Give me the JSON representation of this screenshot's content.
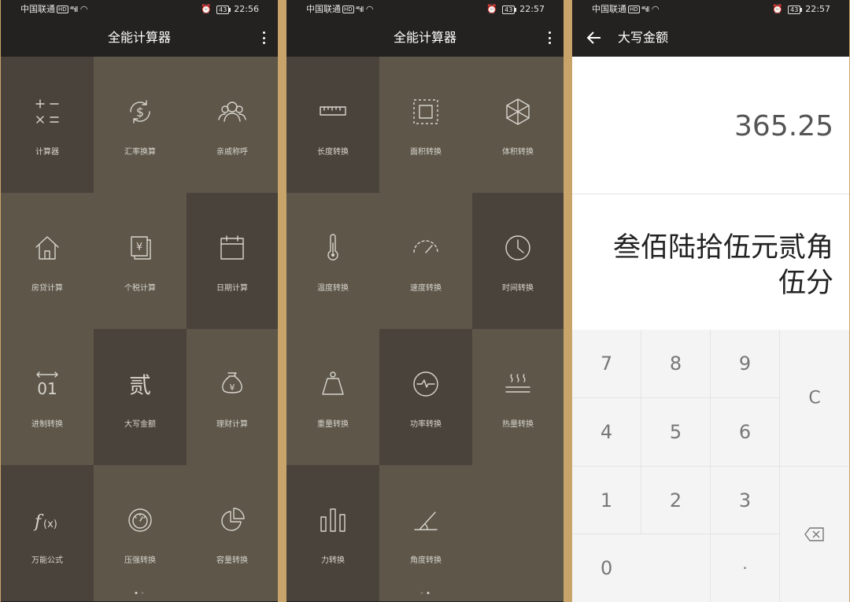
{
  "status": {
    "carrier": "中国联通",
    "hd": "HD",
    "signal": "⁴⁶ıll",
    "battery": "43",
    "time1": "22:56",
    "time2": "22:57",
    "time3": "22:57"
  },
  "app_title": "全能计算器",
  "page1_tiles": [
    {
      "label": "计算器",
      "icon": "plus-minus-times-equals-icon"
    },
    {
      "label": "汇率换算",
      "icon": "currency-exchange-icon"
    },
    {
      "label": "亲戚称呼",
      "icon": "people-group-icon"
    },
    {
      "label": "房贷计算",
      "icon": "house-icon"
    },
    {
      "label": "个税计算",
      "icon": "tax-document-icon"
    },
    {
      "label": "日期计算",
      "icon": "calendar-icon"
    },
    {
      "label": "进制转换",
      "icon": "binary-icon"
    },
    {
      "label": "大写金额",
      "icon": "uppercase-amount-icon",
      "glyph": "贰"
    },
    {
      "label": "理财计算",
      "icon": "money-bag-icon"
    },
    {
      "label": "万能公式",
      "icon": "formula-icon"
    },
    {
      "label": "压强转换",
      "icon": "pressure-gauge-icon"
    },
    {
      "label": "容量转换",
      "icon": "pie-chart-icon"
    }
  ],
  "page2_tiles": [
    {
      "label": "长度转换",
      "icon": "ruler-icon"
    },
    {
      "label": "面积转换",
      "icon": "area-icon"
    },
    {
      "label": "体积转换",
      "icon": "cube-icon"
    },
    {
      "label": "温度转换",
      "icon": "thermometer-icon"
    },
    {
      "label": "速度转换",
      "icon": "speedometer-icon"
    },
    {
      "label": "时间转换",
      "icon": "clock-icon"
    },
    {
      "label": "重量转换",
      "icon": "weight-icon"
    },
    {
      "label": "功率转换",
      "icon": "power-icon"
    },
    {
      "label": "热量转换",
      "icon": "heat-icon"
    },
    {
      "label": "力转换",
      "icon": "force-bars-icon"
    },
    {
      "label": "角度转换",
      "icon": "angle-icon"
    }
  ],
  "amount_screen": {
    "title": "大写金额",
    "value": "365.25",
    "words": "叁佰陆拾伍元贰角伍分",
    "keys": {
      "k7": "7",
      "k8": "8",
      "k9": "9",
      "clear": "C",
      "k4": "4",
      "k5": "5",
      "k6": "6",
      "k1": "1",
      "k2": "2",
      "k3": "3",
      "k0": "0",
      "dot": "·"
    }
  },
  "colors": {
    "tile_light": "#5d5649",
    "tile_dark": "#4a433c",
    "bar": "#232220"
  }
}
